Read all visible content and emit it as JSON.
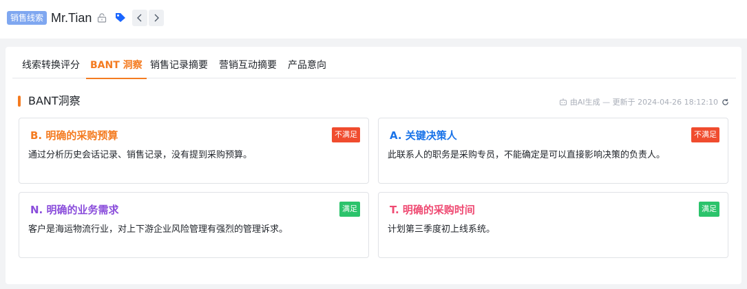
{
  "header": {
    "tag": "销售线索",
    "title": "Mr.Tian"
  },
  "tabs": [
    {
      "label": "线索转换评分",
      "active": false
    },
    {
      "label": "BANT 洞察",
      "active": true
    },
    {
      "label": "销售记录摘要",
      "active": false
    },
    {
      "label": "营销互动摘要",
      "active": false
    },
    {
      "label": "产品意向",
      "active": false
    }
  ],
  "section": {
    "title": "BANT洞察",
    "ai_generated": "由AI生成 — 更新于 2024-04-26 18:12:10"
  },
  "cards": [
    {
      "title": "B. 明确的采购预算",
      "desc": "通过分析历史会话记录、销售记录，没有提到采购预算。",
      "status": "不满足",
      "title_color": "#f47b20",
      "status_color": "#f04c2e"
    },
    {
      "title": "A. 关键决策人",
      "desc": "此联系人的职务是采购专员，不能确定是可以直接影响决策的负责人。",
      "status": "不满足",
      "title_color": "#1a73e8",
      "status_color": "#f04c2e"
    },
    {
      "title": "N. 明确的业务需求",
      "desc": "客户是海运物流行业，对上下游企业风险管理有强烈的管理诉求。",
      "status": "满足",
      "title_color": "#8a4ddb",
      "status_color": "#2bc36b"
    },
    {
      "title": "T. 明确的采购时间",
      "desc": "计划第三季度初上线系统。",
      "status": "满足",
      "title_color": "#ef4a72",
      "status_color": "#2bc36b"
    }
  ],
  "colors": {
    "accent": "#f47b20",
    "tag_bg": "#7fa7f0"
  }
}
